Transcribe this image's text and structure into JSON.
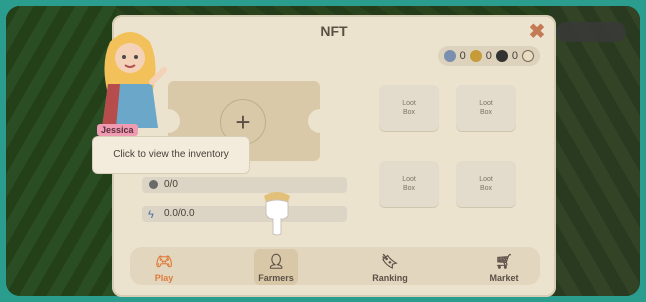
{
  "panel": {
    "title": "NFT"
  },
  "currency": {
    "values": [
      "0",
      "0",
      "0"
    ],
    "icons": [
      "blue-coin-icon",
      "gold-coin-icon",
      "dark-coin-icon",
      "gem-icon"
    ]
  },
  "stats": {
    "slots": "0/0",
    "energy": "0.0/0.0"
  },
  "lootboxes": [
    {
      "line1": "Loot",
      "line2": "Box"
    },
    {
      "line1": "Loot",
      "line2": "Box"
    },
    {
      "line1": "Loot",
      "line2": "Box"
    },
    {
      "line1": "Loot",
      "line2": "Box"
    }
  ],
  "character": {
    "name": "Jessica",
    "tooltip": "Click to view the inventory"
  },
  "nav": {
    "items": [
      {
        "label": "Play",
        "icon": "gamepad-icon"
      },
      {
        "label": "Farmers",
        "icon": "farmer-icon",
        "active": true
      },
      {
        "label": "Ranking",
        "icon": "bookmark-icon"
      },
      {
        "label": "Market",
        "icon": "cart-icon"
      }
    ]
  },
  "colors": {
    "panel_bg": "#ece3cf",
    "accent_play": "#e07b3a",
    "close": "#c37a55",
    "name_tag": "#ef9bb2"
  }
}
